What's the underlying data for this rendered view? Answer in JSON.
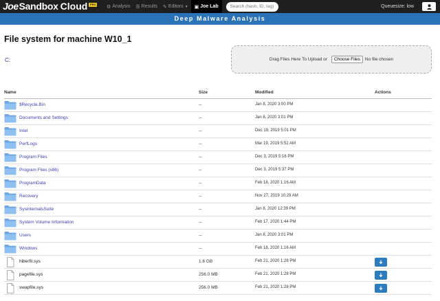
{
  "nav": {
    "logo_joe": "Joe",
    "logo_sandbox": "Sandbox",
    "logo_cloud": "Cloud",
    "pro_badge": "PRO",
    "items": [
      {
        "label": "Analysis",
        "icon": "gear-icon"
      },
      {
        "label": "Results",
        "icon": "list-icon"
      },
      {
        "label": "Editors",
        "icon": "edit-icon"
      },
      {
        "label": "Joe Lab",
        "icon": "window-icon"
      }
    ],
    "search_placeholder": "Search (hash, ID, tag) ...",
    "queue": "Queuesize: low",
    "user_icon": "user-icon"
  },
  "subbar": "Deep Malware Analysis",
  "page_title": "File system for machine W10_1",
  "drive": "C:",
  "upload": {
    "label": "Drag Files Here To Upload or",
    "button": "Choose Files",
    "status": "No file chosen"
  },
  "columns": {
    "name": "Name",
    "size": "Size",
    "modified": "Modified",
    "actions": "Actions"
  },
  "colors": {
    "nav_bg": "#1f1f1f",
    "subbar_bg": "#2b73b8",
    "link": "#3c3cb4",
    "download_btn": "#2c7cc0"
  },
  "files": [
    {
      "type": "folder",
      "name": "$Recycle.Bin",
      "size": "--",
      "modified": "Jan 8, 2020 3:00 PM"
    },
    {
      "type": "folder",
      "name": "Documents and Settings",
      "size": "--",
      "modified": "Jan 8, 2020 3:01 PM"
    },
    {
      "type": "folder",
      "name": "Intel",
      "size": "--",
      "modified": "Dec 19, 2019 5:01 PM"
    },
    {
      "type": "folder",
      "name": "PerfLogs",
      "size": "--",
      "modified": "Mar 19, 2019 5:52 AM"
    },
    {
      "type": "folder",
      "name": "Program Files",
      "size": "--",
      "modified": "Dec 3, 2019 5:16 PM"
    },
    {
      "type": "folder",
      "name": "Program Files (x86)",
      "size": "--",
      "modified": "Dec 3, 2019 5:37 PM"
    },
    {
      "type": "folder",
      "name": "ProgramData",
      "size": "--",
      "modified": "Feb 18, 2020 1:16 AM"
    },
    {
      "type": "folder",
      "name": "Recovery",
      "size": "--",
      "modified": "Nov 27, 2019 10:29 AM"
    },
    {
      "type": "folder",
      "name": "SysinternalsSuite",
      "size": "--",
      "modified": "Jan 8, 2020 12:39 PM"
    },
    {
      "type": "folder",
      "name": "System Volume Information",
      "size": "--",
      "modified": "Feb 17, 2020 1:44 PM"
    },
    {
      "type": "folder",
      "name": "Users",
      "size": "--",
      "modified": "Jan 8, 2020 3:01 PM"
    },
    {
      "type": "folder",
      "name": "Windows",
      "size": "--",
      "modified": "Feb 18, 2020 1:16 AM"
    },
    {
      "type": "file",
      "name": "hiberfil.sys",
      "size": "1.6 GB",
      "modified": "Feb 21, 2020 1:28 PM"
    },
    {
      "type": "file",
      "name": "pagefile.sys",
      "size": "256.0 MB",
      "modified": "Feb 21, 2020 1:28 PM"
    },
    {
      "type": "file",
      "name": "swapfile.sys",
      "size": "256.0 MB",
      "modified": "Feb 21, 2020 1:28 PM"
    }
  ]
}
